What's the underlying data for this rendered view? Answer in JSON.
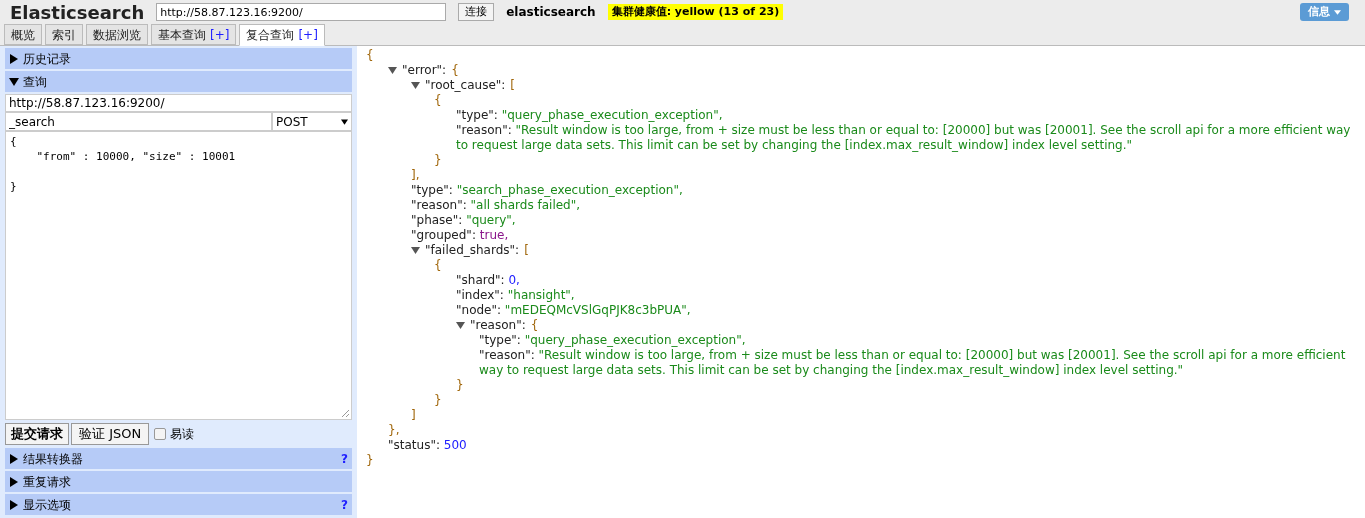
{
  "header": {
    "title": "Elasticsearch",
    "url": "http://58.87.123.16:9200/",
    "connect_button": "连接",
    "cluster_name": "elasticsearch",
    "cluster_health": "集群健康值: yellow (13 of 23)",
    "info_button": "信息"
  },
  "tabs": [
    {
      "label": "概览",
      "selected": false
    },
    {
      "label": "索引",
      "selected": false
    },
    {
      "label": "数据浏览",
      "selected": false
    },
    {
      "label": "基本查询",
      "plus": "[+]",
      "selected": false
    },
    {
      "label": "复合查询",
      "plus": "[+]",
      "selected": true
    }
  ],
  "sidebar": {
    "top_sections": [
      {
        "label": "历史记录",
        "expanded": false
      },
      {
        "label": "查询",
        "expanded": true
      }
    ],
    "query": {
      "url": "http://58.87.123.16:9200/",
      "path": "_search",
      "method": "POST",
      "body": "{\n    \"from\" : 10000, \"size\" : 10001\n\n}",
      "submit_button": "提交请求",
      "validate_button": "验证 JSON",
      "pretty": {
        "label": "易读",
        "checked": false
      }
    },
    "bottom_sections": [
      {
        "label": "结果转换器",
        "expanded": false,
        "help": "?"
      },
      {
        "label": "重复请求",
        "expanded": false
      },
      {
        "label": "显示选项",
        "expanded": false,
        "help": "?"
      }
    ]
  },
  "result": {
    "open": "{",
    "close": "}",
    "children": [
      {
        "key": "\"error\":",
        "open": "{",
        "close": "},",
        "expanded": true,
        "children": [
          {
            "key": "\"root_cause\":",
            "open": "[",
            "close": "],",
            "expanded": true,
            "children": [
              {
                "open": "{",
                "close": "}",
                "children": [
                  {
                    "key": "\"type\":",
                    "kind": "string",
                    "value": "\"query_phase_execution_exception\","
                  },
                  {
                    "key": "\"reason\":",
                    "kind": "string",
                    "value": "\"Result window is too large, from + size must be less than or equal to: [20000] but was [20001]. See the scroll api for a more efficient way to request large data sets. This limit can be set by changing the [index.max_result_window] index level setting.\""
                  }
                ]
              }
            ]
          },
          {
            "key": "\"type\":",
            "kind": "string",
            "value": "\"search_phase_execution_exception\","
          },
          {
            "key": "\"reason\":",
            "kind": "string",
            "value": "\"all shards failed\","
          },
          {
            "key": "\"phase\":",
            "kind": "string",
            "value": "\"query\","
          },
          {
            "key": "\"grouped\":",
            "kind": "boolean",
            "value": "true,"
          },
          {
            "key": "\"failed_shards\":",
            "open": "[",
            "close": "]",
            "expanded": true,
            "children": [
              {
                "open": "{",
                "close": "}",
                "children": [
                  {
                    "key": "\"shard\":",
                    "kind": "number",
                    "value": "0,"
                  },
                  {
                    "key": "\"index\":",
                    "kind": "string",
                    "value": "\"hansight\","
                  },
                  {
                    "key": "\"node\":",
                    "kind": "string",
                    "value": "\"mEDEQMcVSlGqPJK8c3bPUA\","
                  },
                  {
                    "key": "\"reason\":",
                    "open": "{",
                    "close": "}",
                    "expanded": true,
                    "children": [
                      {
                        "key": "\"type\":",
                        "kind": "string",
                        "value": "\"query_phase_execution_exception\","
                      },
                      {
                        "key": "\"reason\":",
                        "kind": "string",
                        "value": "\"Result window is too large, from + size must be less than or equal to: [20000] but was [20001]. See the scroll api for a more efficient way to request large data sets. This limit can be set by changing the [index.max_result_window] index level setting.\""
                      }
                    ]
                  }
                ]
              }
            ]
          }
        ]
      },
      {
        "key": "\"status\":",
        "kind": "number",
        "value": "500"
      }
    ]
  }
}
